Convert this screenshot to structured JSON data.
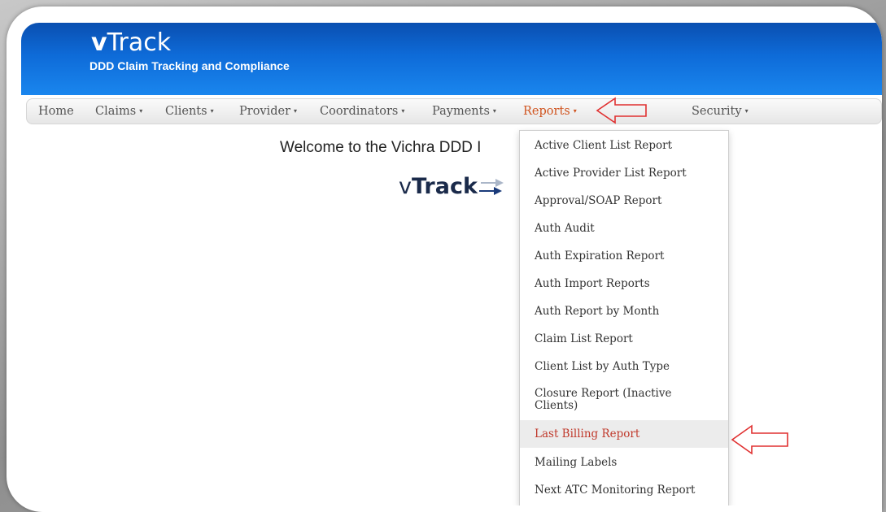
{
  "header": {
    "brand_v": "v",
    "brand_rest": "Track",
    "tagline": "DDD Claim Tracking and Compliance"
  },
  "nav": {
    "items": [
      {
        "label": "Home",
        "caret": false
      },
      {
        "label": "Claims",
        "caret": true
      },
      {
        "label": "Clients",
        "caret": true
      },
      {
        "label": "Provider",
        "caret": true
      },
      {
        "label": "Coordinators",
        "caret": true
      },
      {
        "label": "Payments",
        "caret": true
      },
      {
        "label": "Reports",
        "caret": true,
        "active": true
      },
      {
        "label": "Security",
        "caret": true
      }
    ],
    "caret_glyph": "▾"
  },
  "main": {
    "welcome": "Welcome to the Vichra DDD I",
    "logo_v": "v",
    "logo_rest": "Track"
  },
  "reports_menu": {
    "items": [
      "Active Client List Report",
      "Active Provider List Report",
      "Approval/SOAP Report",
      "Auth Audit",
      "Auth Expiration Report",
      "Auth Import Reports",
      "Auth Report by Month",
      "Claim List Report",
      "Client List by Auth Type",
      "Closure Report (Inactive Clients)",
      "Last Billing Report",
      "Mailing Labels",
      "Next ATC Monitoring Report"
    ],
    "highlighted": "Last Billing Report"
  },
  "colors": {
    "header_blue": "#0e6bd8",
    "active_nav": "#d0541f",
    "highlight_text": "#c0392b",
    "annotation_arrow": "#e03030"
  },
  "annotations": [
    "left-arrow-icon",
    "left-arrow-icon"
  ]
}
